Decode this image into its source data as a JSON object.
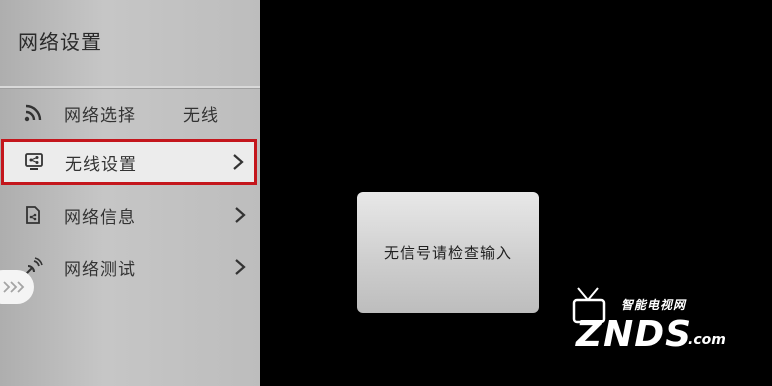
{
  "panel": {
    "title": "网络设置",
    "items": [
      {
        "label": "网络选择",
        "value": "无线",
        "icon": "wifi-icon"
      },
      {
        "label": "无线设置",
        "icon": "wireless-settings-icon",
        "selected": true
      },
      {
        "label": "网络信息",
        "icon": "network-info-icon"
      },
      {
        "label": "网络测试",
        "icon": "network-test-icon"
      }
    ]
  },
  "dialog": {
    "message": "无信号请检查输入"
  },
  "watermark": {
    "tagline": "智能电视网",
    "brand": "ZNDS",
    "suffix": ".com"
  },
  "colors": {
    "selection_border": "#c4161c",
    "panel_bg": "#c2c2c2",
    "background": "#000000"
  }
}
